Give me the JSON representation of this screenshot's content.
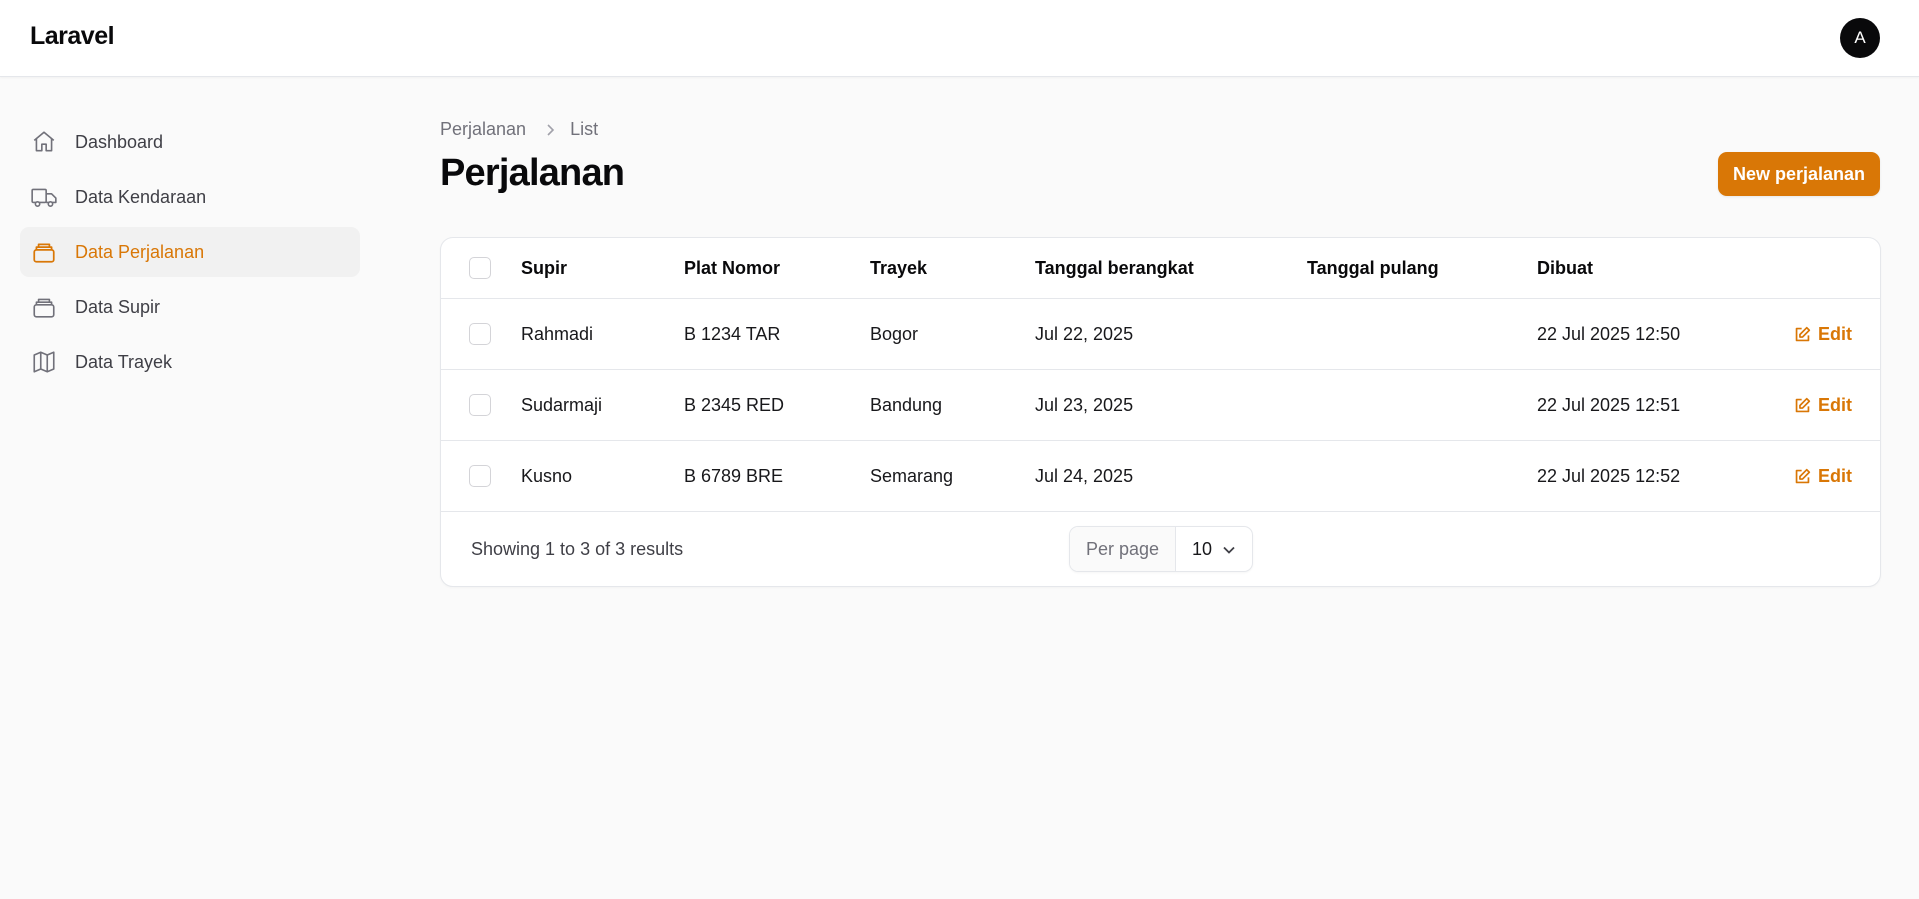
{
  "app": {
    "brand": "Laravel",
    "avatar_initial": "A",
    "accent_color": "#d97706"
  },
  "sidebar": {
    "items": [
      {
        "label": "Dashboard",
        "icon": "home-icon",
        "active": false
      },
      {
        "label": "Data Kendaraan",
        "icon": "truck-icon",
        "active": false
      },
      {
        "label": "Data Perjalanan",
        "icon": "stack-icon",
        "active": true
      },
      {
        "label": "Data Supir",
        "icon": "stack-icon",
        "active": false
      },
      {
        "label": "Data Trayek",
        "icon": "map-icon",
        "active": false
      }
    ]
  },
  "breadcrumb": {
    "items": [
      "Perjalanan",
      "List"
    ]
  },
  "page": {
    "title": "Perjalanan",
    "new_button_label": "New perjalanan"
  },
  "table": {
    "columns": [
      "Supir",
      "Plat Nomor",
      "Trayek",
      "Tanggal berangkat",
      "Tanggal pulang",
      "Dibuat"
    ],
    "rows": [
      {
        "supir": "Rahmadi",
        "plat": "B 1234 TAR",
        "trayek": "Bogor",
        "berangkat": "Jul 22, 2025",
        "pulang": "",
        "dibuat": "22 Jul 2025 12:50",
        "action": "Edit"
      },
      {
        "supir": "Sudarmaji",
        "plat": "B 2345 RED",
        "trayek": "Bandung",
        "berangkat": "Jul 23, 2025",
        "pulang": "",
        "dibuat": "22 Jul 2025 12:51",
        "action": "Edit"
      },
      {
        "supir": "Kusno",
        "plat": "B 6789 BRE",
        "trayek": "Semarang",
        "berangkat": "Jul 24, 2025",
        "pulang": "",
        "dibuat": "22 Jul 2025 12:52",
        "action": "Edit"
      }
    ]
  },
  "pagination": {
    "showing_text": "Showing 1 to 3 of 3 results",
    "per_page_label": "Per page",
    "per_page_value": "10"
  }
}
